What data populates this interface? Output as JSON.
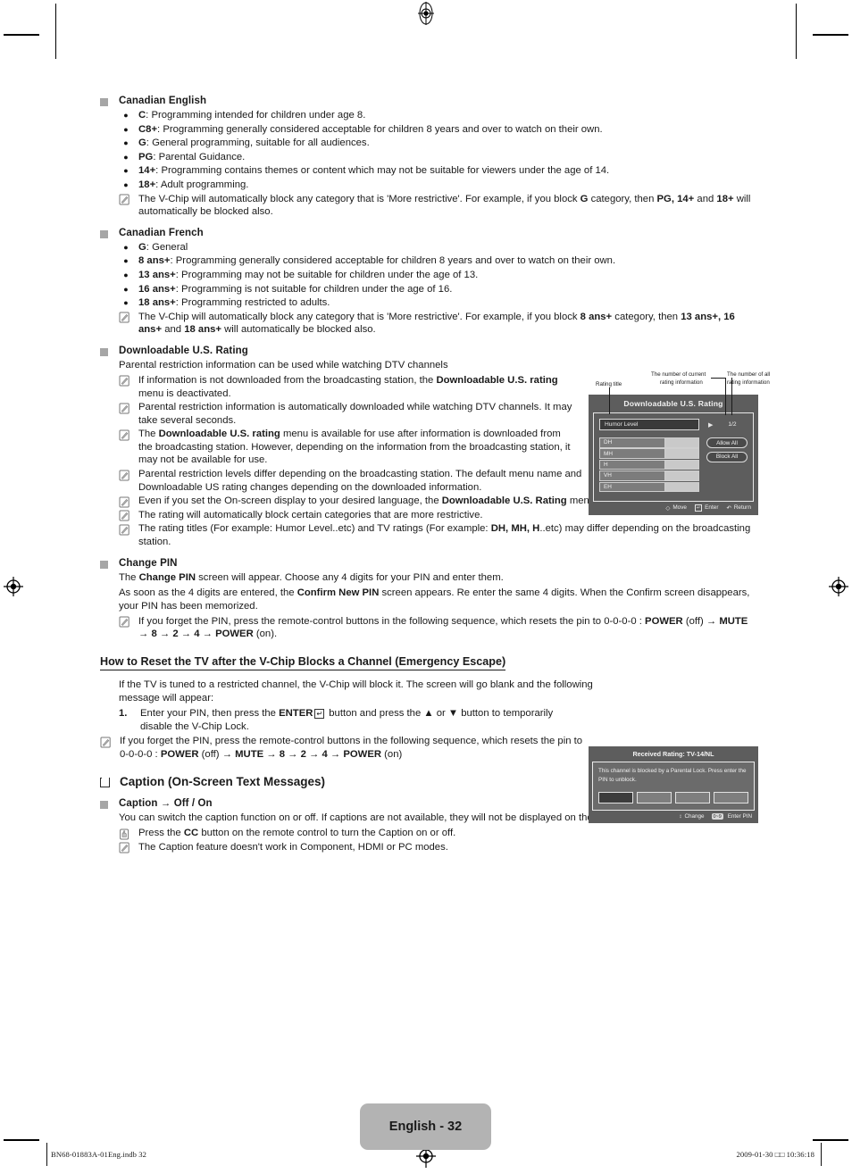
{
  "sections": {
    "canadian_english": {
      "heading": "Canadian English",
      "bullets": [
        {
          "term": "C",
          "rest": ": Programming intended for children under age 8."
        },
        {
          "term": "C8+",
          "rest": ": Programming generally considered acceptable for children 8 years and over to watch on their own."
        },
        {
          "term": "G",
          "rest": ": General programming, suitable for all audiences."
        },
        {
          "term": "PG",
          "rest": ": Parental Guidance."
        },
        {
          "term": "14+",
          "rest": ": Programming contains themes or content which may not be suitable for viewers under the age of 14."
        },
        {
          "term": "18+",
          "rest": ": Adult programming."
        }
      ],
      "note": "The V-Chip will automatically block any category that is 'More restrictive'. For example, if you block G category, then PG, 14+ and 18+ will automatically be blocked also."
    },
    "canadian_french": {
      "heading": "Canadian French",
      "bullets": [
        {
          "term": "G",
          "rest": ": General"
        },
        {
          "term": "8 ans+",
          "rest": ": Programming generally considered acceptable for children 8 years and over to watch on their own."
        },
        {
          "term": "13 ans+",
          "rest": ": Programming may not be suitable for children under the age of 13."
        },
        {
          "term": "16 ans+",
          "rest": ": Programming is not suitable for children under the age of 16."
        },
        {
          "term": "18 ans+",
          "rest": ": Programming restricted to adults."
        }
      ],
      "note": "The V-Chip will automatically block any category that is 'More restrictive'. For example, if you block 8 ans+ category, then 13 ans+, 16 ans+ and 18 ans+ will automatically be blocked also."
    },
    "downloadable": {
      "heading": "Downloadable U.S. Rating",
      "intro": "Parental restriction information can be used while watching DTV channels",
      "notes": [
        "If information is not downloaded from the broadcasting station, the Downloadable U.S. rating menu is deactivated.",
        "Parental restriction information is automatically downloaded while watching DTV channels. It may take several seconds.",
        "The Downloadable U.S. rating menu is available for use after information is downloaded from the broadcasting station. However, depending on the information from the broadcasting station, it may not be available for use.",
        "Parental restriction levels differ depending on the broadcasting station. The default menu name and Downloadable US rating changes depending on the downloaded information.",
        "Even if you set the On-screen display to your desired language, the Downloadable U.S. Rating menu will appear in English only.",
        "The rating will automatically block certain categories that are more restrictive.",
        "The rating titles (For example: Humor Level..etc) and TV ratings (For example: DH, MH, H..etc) may differ depending on the broadcasting station."
      ]
    },
    "change_pin": {
      "heading": "Change PIN",
      "para1": "The Change PIN screen will appear. Choose any 4 digits for your PIN and enter them.",
      "para2": "As soon as the 4 digits are entered, the Confirm New PIN screen appears. Re enter the same 4 digits. When the Confirm screen disappears, your PIN has been memorized.",
      "note": "If you forget the PIN, press the remote-control buttons in the following sequence, which resets the pin to 0-0-0-0 : POWER (off) → MUTE → 8 → 2 → 4 → POWER (on)."
    },
    "reset_tv": {
      "heading": "How to Reset the TV after the V-Chip Blocks a Channel (Emergency Escape)",
      "para1": "If the TV is tuned to a restricted channel, the V-Chip will block it. The screen will go blank and the following message will appear:",
      "step_number": "1.",
      "step_text": "Enter your PIN, then press the ENTER ↵ button and press the ▲ or ▼ button to temporarily disable the V-Chip Lock.",
      "note": "If you forget the PIN, press the remote-control buttons in the following sequence, which resets the pin to 0-0-0-0 : POWER (off) → MUTE → 8 → 2 → 4 → POWER (on)"
    },
    "caption": {
      "heading": "Caption (On-Screen Text Messages)",
      "sub_heading": "Caption → Off / On",
      "para": "You can switch the caption function on or off. If captions are not available, they will not be displayed on the screen.",
      "note_press": "Press the CC button on the remote control to turn the Caption on or off.",
      "note_pencil": "The Caption feature doesn't work in Component, HDMI or PC modes."
    }
  },
  "osd_rating": {
    "callout_rating_title": "Rating title",
    "callout_current_line1": "The number of current",
    "callout_current_line2": "rating information",
    "callout_all_line1": "The number of all",
    "callout_all_line2": "rating information",
    "title": "Downloadable U.S. Rating",
    "selected_item": "Humor Level",
    "arrow_glyph": "▶",
    "count": "1/2",
    "rows": [
      "DH",
      "MH",
      "H",
      "VH",
      "EH"
    ],
    "buttons": [
      "Allow All",
      "Block All"
    ],
    "footer": [
      {
        "icon": "dpad-icon",
        "label": "Move"
      },
      {
        "icon": "enter-icon",
        "label": "Enter"
      },
      {
        "icon": "return-icon",
        "label": "Return"
      }
    ]
  },
  "osd_blocked": {
    "title": "Received Rating: TV-14/NL",
    "message": "This channel is blocked by a Parental Lock. Press enter the PIN to unblock.",
    "pin_boxes": 4,
    "footer": [
      {
        "icon": "updown-icon",
        "label": "Change"
      },
      {
        "icon": "numeric-keys-icon",
        "keycap": "0~9",
        "label": "Enter PIN"
      }
    ]
  },
  "footer": {
    "page_label": "English - 32",
    "file_info": "BN68-01883A-01Eng.indb   32",
    "timestamp": "2009-01-30   □□ 10:36:18"
  }
}
